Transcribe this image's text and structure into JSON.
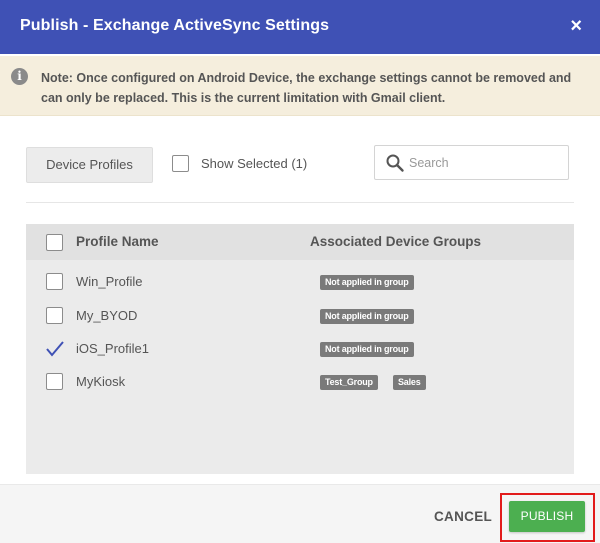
{
  "dialog": {
    "title": "Publish - Exchange ActiveSync Settings",
    "close_icon": "×"
  },
  "note": {
    "icon": "i",
    "text": "Note: Once configured on Android Device, the exchange settings cannot be removed and can only be replaced. This is the current limitation with Gmail client."
  },
  "toolbar": {
    "device_profiles_label": "Device Profiles",
    "show_selected_label": "Show Selected (1)",
    "search_placeholder": "Search"
  },
  "table": {
    "headers": {
      "profile_name": "Profile Name",
      "groups": "Associated Device Groups"
    },
    "rows": [
      {
        "name": "Win_Profile",
        "checked": false,
        "groups": [
          "Not applied in group"
        ]
      },
      {
        "name": "My_BYOD",
        "checked": false,
        "groups": [
          "Not applied in group"
        ]
      },
      {
        "name": "iOS_Profile1",
        "checked": true,
        "groups": [
          "Not applied in group"
        ]
      },
      {
        "name": "MyKiosk",
        "checked": false,
        "groups": [
          "Test_Group",
          "Sales"
        ]
      }
    ]
  },
  "footer": {
    "cancel_label": "CANCEL",
    "publish_label": "PUBLISH"
  },
  "colors": {
    "header": "#3f51b5",
    "note_bg": "#f5eedd",
    "publish": "#4caf50",
    "highlight": "#e21b1b",
    "checkmark": "#3f51b5"
  }
}
